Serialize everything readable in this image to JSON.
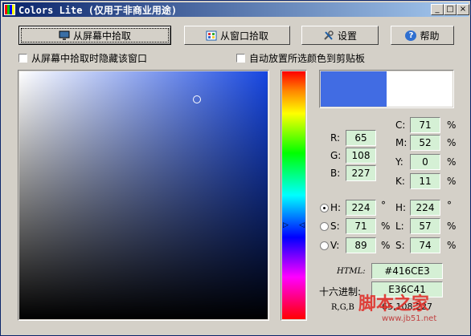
{
  "window": {
    "title": "Colors Lite (仅用于非商业用途)",
    "controls": {
      "minimize": "_",
      "maximize": "□",
      "close": "×"
    }
  },
  "toolbar": {
    "pick_screen": "从屏幕中拾取",
    "pick_window": "从窗口拾取",
    "settings": "设置",
    "help": "帮助",
    "help_icon": "?"
  },
  "options": {
    "hide_window": "从屏幕中拾取时隐藏该窗口",
    "auto_copy": "自动放置所选颜色到剪贴板"
  },
  "colors": {
    "selected": "#416CE3",
    "compare": "#FFFFFF",
    "field_bg": "#D5F0D5"
  },
  "rgb": {
    "r_label": "R:",
    "r": "65",
    "g_label": "G:",
    "g": "108",
    "b_label": "B:",
    "b": "227"
  },
  "cmyk": {
    "c_label": "C:",
    "c": "71",
    "m_label": "M:",
    "m": "52",
    "y_label": "Y:",
    "y": "0",
    "k_label": "K:",
    "k": "11",
    "unit": "%"
  },
  "hsv": {
    "h_label": "H:",
    "h": "224",
    "h_unit": "°",
    "s_label": "S:",
    "s": "71",
    "s_unit": "%",
    "v_label": "V:",
    "v": "89",
    "v_unit": "%"
  },
  "hsl": {
    "h_label": "H:",
    "h": "224",
    "h_unit": "°",
    "l_label": "L:",
    "l": "57",
    "l_unit": "%",
    "s_label": "S:",
    "s": "74",
    "s_unit": "%"
  },
  "codes": {
    "html_label": "HTML:",
    "html": "#416CE3",
    "hex_label": "十六进制:",
    "hex": "E36C41",
    "rgb_label": "R,G,B",
    "rgb": "65,108,227"
  },
  "watermark": {
    "text": "脚本之家",
    "url": "www.jb51.net"
  }
}
